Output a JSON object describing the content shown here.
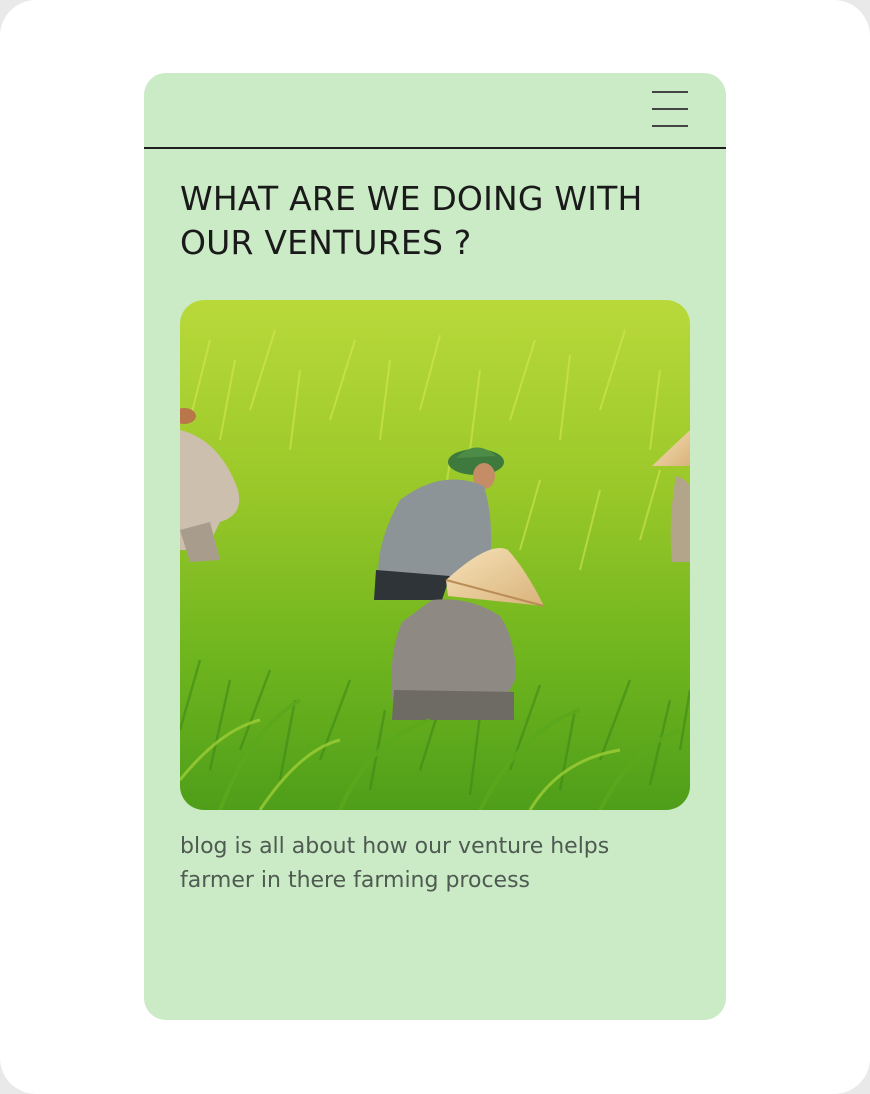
{
  "header": {
    "menu_icon": "hamburger-menu-icon"
  },
  "main": {
    "title": "WHAT ARE WE DOING WITH OUR VENTURES ?",
    "image": {
      "subject": "farmers harvesting in a green rice field",
      "icon": "rice-field-photo"
    },
    "caption": "blog is all about how our venture helps farmer in there farming process"
  },
  "colors": {
    "card_background": "#caebc5",
    "page_background": "#ffffff",
    "rule": "#1f1f1f",
    "title_text": "#1a1a1a",
    "caption_text": "#4f5a52"
  }
}
